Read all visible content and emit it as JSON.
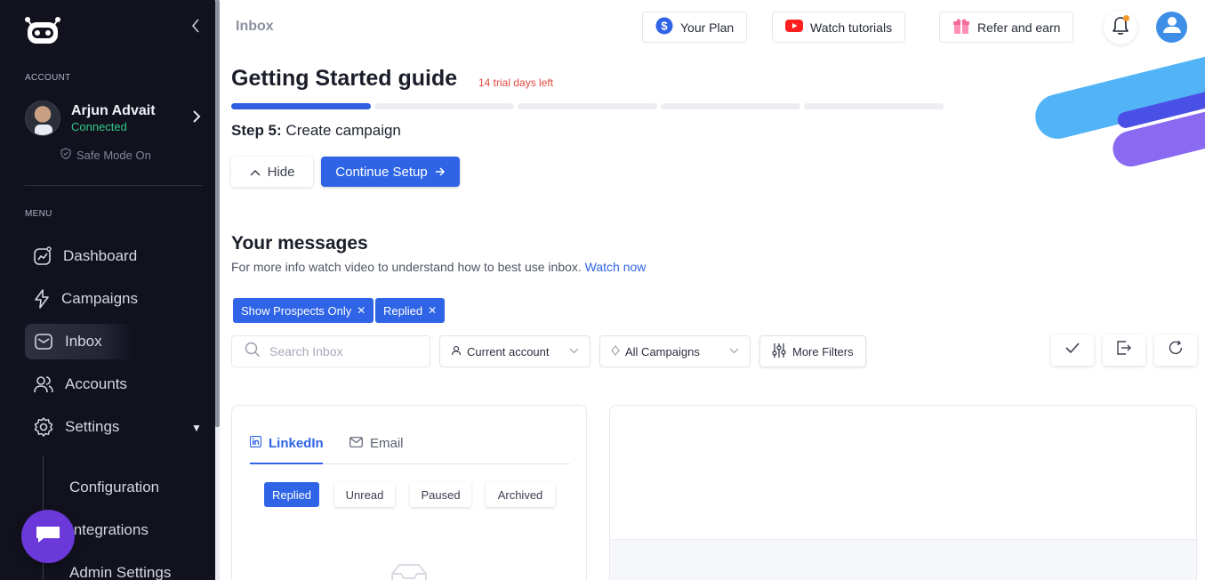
{
  "sidebar": {
    "section_account": "ACCOUNT",
    "profile": {
      "name": "Arjun Advait",
      "status": "Connected"
    },
    "safe_mode": "Safe Mode On",
    "section_menu": "MENU",
    "items": [
      {
        "label": "Dashboard",
        "icon": "dashboard-icon"
      },
      {
        "label": "Campaigns",
        "icon": "lightning-icon"
      },
      {
        "label": "Inbox",
        "icon": "inbox-icon",
        "active": true
      },
      {
        "label": "Accounts",
        "icon": "users-icon"
      },
      {
        "label": "Settings",
        "icon": "gear-icon"
      }
    ],
    "sub_items": [
      {
        "label": "Configuration"
      },
      {
        "label": "Integrations"
      },
      {
        "label": "Admin Settings"
      }
    ]
  },
  "header": {
    "page": "Inbox",
    "plan_label": "Your Plan",
    "tutorials_label": "Watch tutorials",
    "refer_label": "Refer and earn"
  },
  "guide": {
    "title": "Getting Started guide",
    "trial": "14 trial days left",
    "progress_done": 1,
    "progress_total": 5,
    "step_prefix": "Step 5:",
    "step_text": "Create campaign",
    "hide_label": "Hide",
    "continue_label": "Continue Setup"
  },
  "messages": {
    "title": "Your messages",
    "subtitle": "For more info watch video to understand how to best use inbox.",
    "watch_link": "Watch now",
    "chips": [
      {
        "label": "Show Prospects Only"
      },
      {
        "label": "Replied"
      }
    ],
    "search_placeholder": "Search Inbox",
    "account_dropdown": "Current account",
    "campaign_dropdown": "All Campaigns",
    "more_filters": "More Filters"
  },
  "inbox_panel": {
    "tabs": [
      {
        "label": "LinkedIn",
        "active": true
      },
      {
        "label": "Email"
      }
    ],
    "filters": [
      {
        "label": "Replied",
        "active": true
      },
      {
        "label": "Unread"
      },
      {
        "label": "Paused"
      },
      {
        "label": "Archived"
      }
    ]
  },
  "colors": {
    "sidebar_bg": "#12121f",
    "accent": "#2f64e6",
    "status_connected": "#2ec98a",
    "trial_red": "#e0483e",
    "chat_purple": "#6b38d9"
  }
}
